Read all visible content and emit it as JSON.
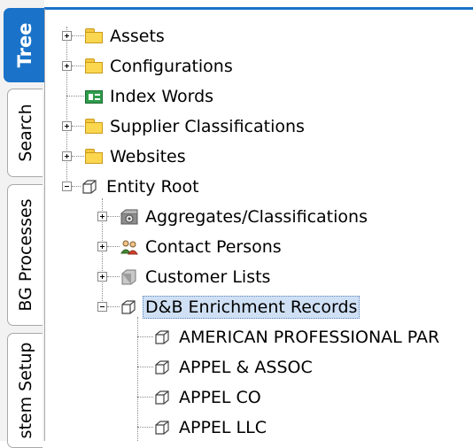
{
  "tabs": [
    {
      "label": "Tree",
      "active": true
    },
    {
      "label": "Search",
      "active": false
    },
    {
      "label": "BG Processes",
      "active": false
    },
    {
      "label": "stem Setup",
      "active": false
    }
  ],
  "tree": {
    "nodes": [
      {
        "label": "Assets",
        "icon": "folder-icon",
        "expander": "plus"
      },
      {
        "label": "Configurations",
        "icon": "folder-icon",
        "expander": "plus"
      },
      {
        "label": "Index Words",
        "icon": "index-words-icon",
        "expander": "none"
      },
      {
        "label": "Supplier Classifications",
        "icon": "folder-icon",
        "expander": "plus"
      },
      {
        "label": "Websites",
        "icon": "folder-icon",
        "expander": "plus"
      },
      {
        "label": "Entity Root",
        "icon": "entity-cube-icon",
        "expander": "minus"
      },
      {
        "label": "Aggregates/Classifications",
        "icon": "aggregates-icon",
        "expander": "plus"
      },
      {
        "label": "Contact Persons",
        "icon": "contact-persons-icon",
        "expander": "plus"
      },
      {
        "label": "Customer Lists",
        "icon": "customer-list-icon",
        "expander": "plus"
      },
      {
        "label": "D&B Enrichment Records",
        "icon": "entity-cube-icon",
        "expander": "minus",
        "selected": true
      },
      {
        "label": "AMERICAN PROFESSIONAL PAR",
        "icon": "entity-cube-icon",
        "expander": "none"
      },
      {
        "label": "APPEL & ASSOC",
        "icon": "entity-cube-icon",
        "expander": "none"
      },
      {
        "label": "APPEL CO",
        "icon": "entity-cube-icon",
        "expander": "none"
      },
      {
        "label": "APPEL LLC",
        "icon": "entity-cube-icon",
        "expander": "none"
      }
    ]
  },
  "colors": {
    "accent": "#1a73c9",
    "selection_bg": "#cfe0f5",
    "folder": "#fbd64f"
  }
}
